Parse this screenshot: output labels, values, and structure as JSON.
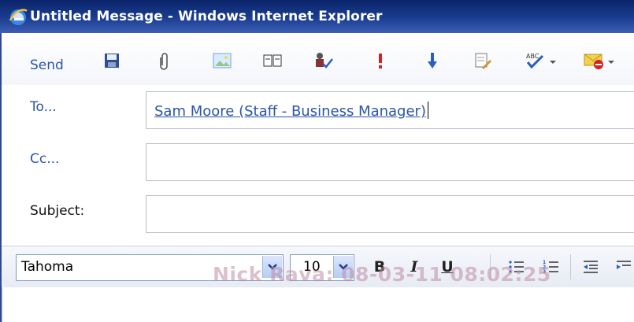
{
  "window": {
    "title": "Untitled Message - Windows Internet Explorer"
  },
  "toolbar": {
    "send_label": "Send",
    "icons": [
      "save-icon",
      "attach-icon",
      "insert-image-icon",
      "address-book-icon",
      "check-names-icon",
      "importance-high-icon",
      "importance-low-icon",
      "options-icon",
      "spell-check-icon",
      "flag-icon"
    ]
  },
  "fields": {
    "to_label": "To...",
    "to_value": "Sam Moore (Staff - Business Manager)",
    "cc_label": "Cc...",
    "cc_value": "",
    "subject_label": "Subject:",
    "subject_value": ""
  },
  "format": {
    "font": "Tahoma",
    "size": "10",
    "bold": "B",
    "italic": "I",
    "underline": "U"
  },
  "watermark": "Nick Rava: 08-03-11 08:02:25"
}
